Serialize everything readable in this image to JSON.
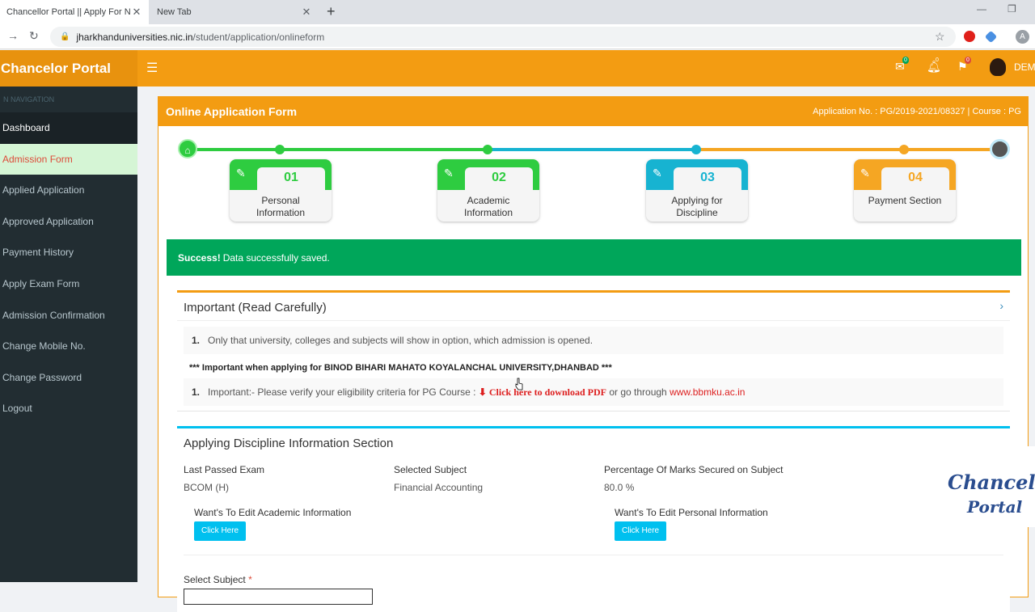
{
  "browser": {
    "tabs": [
      {
        "title": "Chancellor Portal || Apply For Ne"
      },
      {
        "title": "New Tab"
      }
    ],
    "url_host": "jharkhanduniversities.nic.in",
    "url_path": "/student/application/onlineform",
    "profile_initial": "A"
  },
  "header": {
    "brand": "Chancelor Portal",
    "mail_count": "0",
    "bell_count": "0",
    "flag_count": "0",
    "user_name": "DEMO"
  },
  "sidebar": {
    "section_label": "N NAVIGATION",
    "items": [
      {
        "label": "Dashboard"
      },
      {
        "label": "Admission Form"
      },
      {
        "label": "Applied Application"
      },
      {
        "label": "Approved Application"
      },
      {
        "label": "Payment History"
      },
      {
        "label": "Apply Exam Form"
      },
      {
        "label": "Admission Confirmation"
      },
      {
        "label": "Change Mobile No."
      },
      {
        "label": "Change Password"
      },
      {
        "label": "Logout"
      }
    ]
  },
  "form": {
    "title": "Online Application Form",
    "application_info": "Application No. : PG/2019-2021/08327 | Course : PG"
  },
  "steps": [
    {
      "num": "01",
      "line1": "Personal",
      "line2": "Information",
      "color": "#2ecc40"
    },
    {
      "num": "02",
      "line1": "Academic",
      "line2": "Information",
      "color": "#2ecc40"
    },
    {
      "num": "03",
      "line1": "Applying for",
      "line2": "Discipline",
      "color": "#17b3d1"
    },
    {
      "num": "04",
      "line1": "Payment Section",
      "line2": "",
      "color": "#f5a623"
    }
  ],
  "alert": {
    "strong": "Success!",
    "message": "Data successfully saved."
  },
  "important": {
    "title": "Important (Read Carefully)",
    "note1_num": "1.",
    "note1": "Only that university, colleges and subjects will show in option, which admission is opened.",
    "university_line": "*** Important when applying for BINOD BIHARI MAHATO KOYALANCHAL UNIVERSITY,DHANBAD ***",
    "note2_num": "1.",
    "note2_prefix": "Important:- Please verify your eligibility criteria for PG Course :",
    "note2_link": "Click here to download PDF",
    "note2_mid": "or go through",
    "note2_url": "www.bbmku.ac.in"
  },
  "discipline": {
    "title": "Applying Discipline Information Section",
    "last_exam_label": "Last Passed Exam",
    "last_exam_value": "BCOM (H)",
    "subject_label": "Selected Subject",
    "subject_value": "Financial Accounting",
    "percent_label": "Percentage Of Marks Secured on Subject",
    "percent_value": "80.0 %",
    "edit_academic_label": "Want's To Edit Academic Information",
    "edit_personal_label": "Want's To Edit Personal Information",
    "click_here": "Click Here",
    "select_subject_label": "Select Subject",
    "required_mark": "*"
  },
  "watermark": {
    "line1": "Chancellor",
    "line2": "Portal"
  }
}
